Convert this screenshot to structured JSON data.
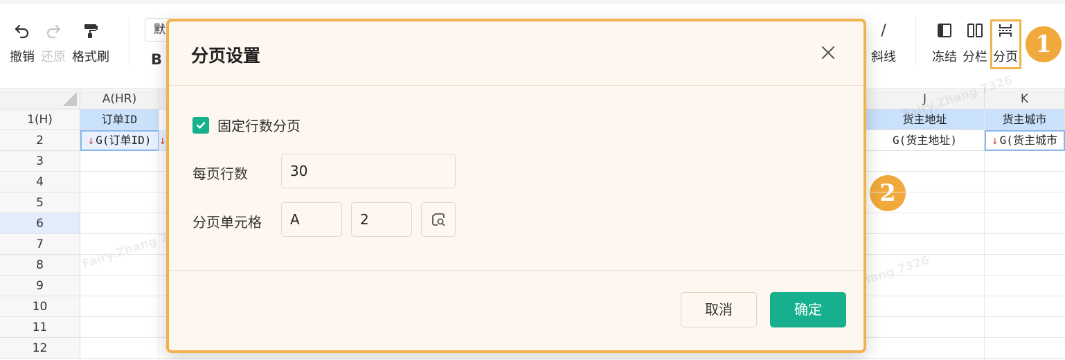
{
  "toolbar": {
    "undo_label": "撤销",
    "redo_label": "还原",
    "format_painter_label": "格式刷",
    "font_name_partial": "默",
    "bold_glyph": "B",
    "diagonal_label": "斜线",
    "diagonal_glyph": "/",
    "freeze_label": "冻结",
    "split_label": "分栏",
    "paging_label": "分页"
  },
  "markers": {
    "step1": "1",
    "step2": "2"
  },
  "sheet": {
    "columns": {
      "A": "A(HR)",
      "J": "J",
      "K": "K"
    },
    "rows": [
      "1(H)",
      "2",
      "3",
      "4",
      "5",
      "6",
      "7",
      "8",
      "9",
      "10",
      "11",
      "12"
    ],
    "row1": {
      "A": "订单ID",
      "J": "货主地址",
      "K": "货主城市"
    },
    "row2": {
      "A": "G(订单ID)",
      "J": "G(货主地址)",
      "K": "G(货主城市"
    },
    "expand_arrow": "↓",
    "watermark_text": "Fairy.Zhang 7326"
  },
  "dialog": {
    "title": "分页设置",
    "fixed_rows_checkbox_label": "固定行数分页",
    "fixed_rows_checked": true,
    "rows_per_page_label": "每页行数",
    "rows_per_page_value": "30",
    "page_cell_label": "分页单元格",
    "page_cell_column": "A",
    "page_cell_row": "2",
    "cancel_label": "取消",
    "ok_label": "确定"
  },
  "colors": {
    "accent": "#17b08e",
    "highlight": "#f0b24a",
    "marker": "#f0a93a",
    "header_cell": "#c9e1fb",
    "dialog_bg": "#fdf7ef"
  }
}
